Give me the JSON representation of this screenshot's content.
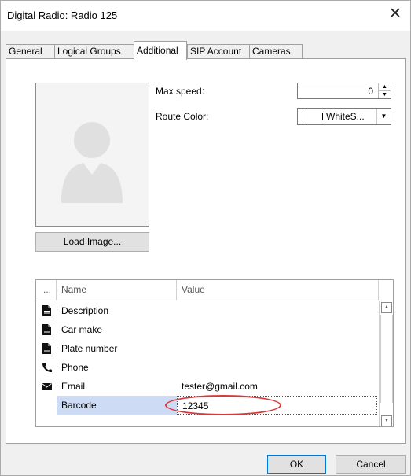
{
  "window": {
    "title": "Digital Radio: Radio 125",
    "close_glyph": "✕"
  },
  "tabs": [
    {
      "label": "General"
    },
    {
      "label": "Logical Groups"
    },
    {
      "label": "Additional"
    },
    {
      "label": "SIP Account"
    },
    {
      "label": "Cameras"
    }
  ],
  "active_tab": "Additional",
  "photo": {
    "load_button_label": "Load Image..."
  },
  "fields": {
    "max_speed_label": "Max speed:",
    "max_speed_value": "0",
    "route_color_label": "Route Color:",
    "route_color_value": "WhiteS...",
    "route_color_swatch": "#ffffff"
  },
  "grid": {
    "columns": [
      "...",
      "Name",
      "Value"
    ],
    "rows": [
      {
        "icon": "document-icon",
        "name": "Description",
        "value": ""
      },
      {
        "icon": "document-icon",
        "name": "Car make",
        "value": ""
      },
      {
        "icon": "document-icon",
        "name": "Plate number",
        "value": ""
      },
      {
        "icon": "phone-icon",
        "name": "Phone",
        "value": ""
      },
      {
        "icon": "envelope-icon",
        "name": "Email",
        "value": "tester@gmail.com"
      },
      {
        "icon": "",
        "name": "Barcode",
        "value": "12345"
      }
    ],
    "selected_row": "Barcode"
  },
  "footer": {
    "ok_label": "OK",
    "cancel_label": "Cancel"
  },
  "colors": {
    "highlight": "#d9383a",
    "selection": "#cddcf4",
    "ok_border": "#0078d7"
  }
}
